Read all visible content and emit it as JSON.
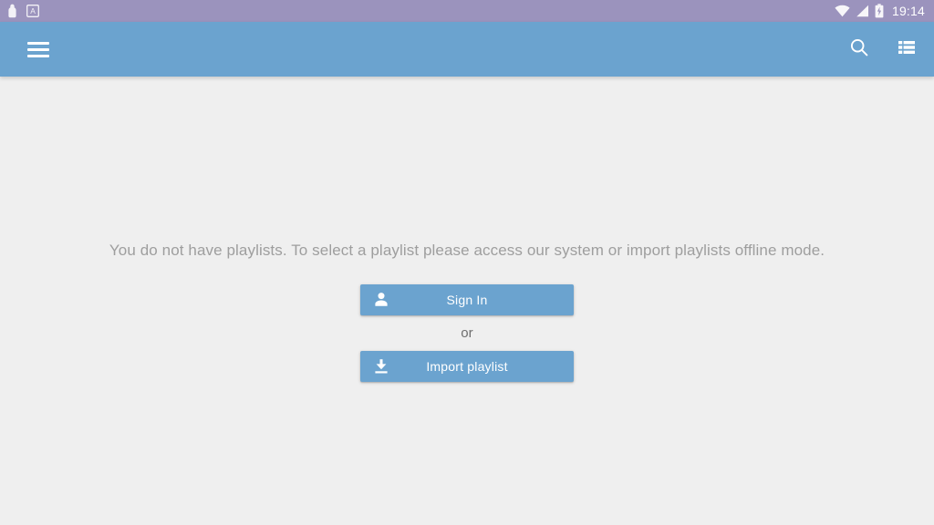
{
  "status_bar": {
    "background_color": "#9b93bd",
    "time": "19:14",
    "left_icons": [
      {
        "name": "usb-debug-icon",
        "label": "USB"
      },
      {
        "name": "letter-a-badge-icon",
        "label": "A"
      }
    ],
    "right_icons": [
      {
        "name": "wifi-icon",
        "label": "Wi-Fi"
      },
      {
        "name": "cellular-signal-icon",
        "label": "Signal"
      },
      {
        "name": "battery-charging-icon",
        "label": "Battery charging"
      }
    ]
  },
  "app_bar": {
    "background_color": "#6ba3cf",
    "title": "",
    "menu_label": "Menu",
    "actions": [
      {
        "name": "search-icon",
        "label": "Search"
      },
      {
        "name": "view-list-icon",
        "label": "View list"
      }
    ]
  },
  "content": {
    "background_color": "#efefef",
    "empty_message": "You do not have playlists. To select a playlist please access our system or import playlists offline mode.",
    "or_label": "or",
    "buttons": [
      {
        "name": "sign-in-button",
        "label": "Sign In",
        "icon": "person-icon",
        "color": "#6ba3cf"
      },
      {
        "name": "import-playlist-button",
        "label": "Import playlist",
        "icon": "download-icon",
        "color": "#6ba3cf"
      }
    ]
  }
}
